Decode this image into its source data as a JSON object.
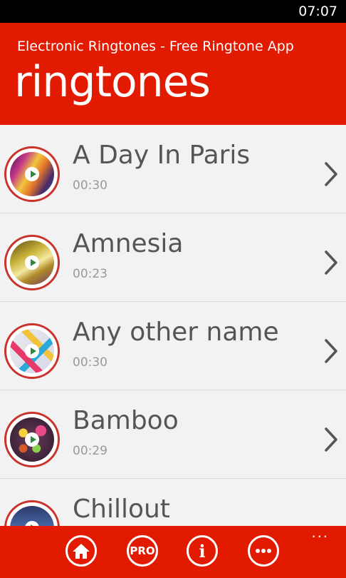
{
  "status_bar": {
    "time": "07:07"
  },
  "header": {
    "app_title": "Electronic Ringtones - Free Ringtone App",
    "page_title": "ringtones"
  },
  "ringtones": [
    {
      "title": "A Day In Paris",
      "duration": "00:30",
      "thumb": "feathers"
    },
    {
      "title": "Amnesia",
      "duration": "00:23",
      "thumb": "silk"
    },
    {
      "title": "Any other name",
      "duration": "00:30",
      "thumb": "mosaic"
    },
    {
      "title": "Bamboo",
      "duration": "00:29",
      "thumb": "bokeh"
    },
    {
      "title": "Chillout",
      "duration": "",
      "thumb": "blue"
    }
  ],
  "app_bar": {
    "home_icon": "home-icon",
    "pro_label": "PRO",
    "info_label": "i",
    "more_icon": "ellipsis-icon",
    "overflow_dots": "..."
  },
  "colors": {
    "accent": "#e21a00",
    "ring": "#c9332c",
    "play": "#2d8a3a"
  }
}
